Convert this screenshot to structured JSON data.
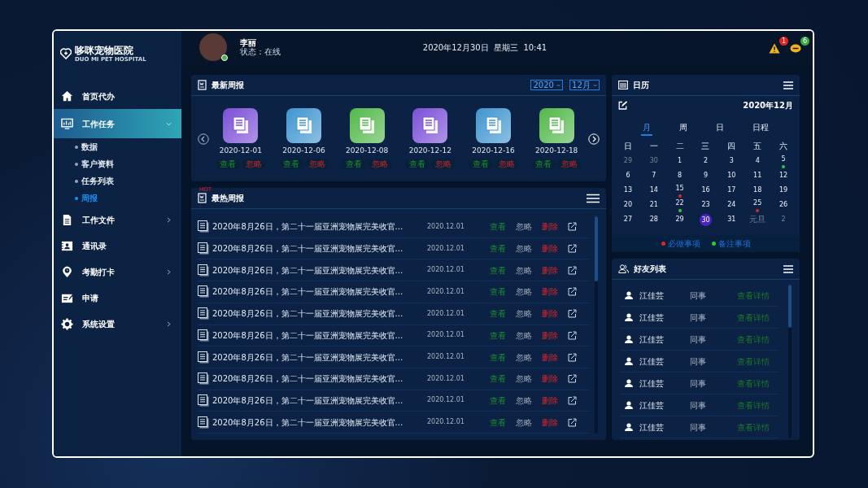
{
  "brand": {
    "name": "哆咪宠物医院",
    "tagline": "DUO MI PET HOSPITAL"
  },
  "sidebar": {
    "items": [
      {
        "kind": "link",
        "label": "首页代办",
        "selected": false
      },
      {
        "kind": "menu",
        "label": "工作任务",
        "selected": true,
        "expanded": true,
        "children": [
          {
            "label": "数据",
            "selected": false
          },
          {
            "label": "客户资料",
            "selected": false
          },
          {
            "label": "任务列表",
            "selected": false
          },
          {
            "label": "周报",
            "selected": true
          }
        ]
      },
      {
        "kind": "menu",
        "label": "工作文件",
        "selected": false,
        "expanded": false
      },
      {
        "kind": "link",
        "label": "通讯录",
        "selected": false
      },
      {
        "kind": "menu",
        "label": "考勤打卡",
        "selected": false,
        "expanded": false
      },
      {
        "kind": "link",
        "label": "申请",
        "selected": false
      },
      {
        "kind": "menu",
        "label": "系统设置",
        "selected": false,
        "expanded": false
      }
    ]
  },
  "header": {
    "user": {
      "name": "李丽",
      "status": "状态：在线",
      "online": true
    },
    "datetime": "2020年12月30日  星期三  10:41",
    "alerts": [
      {
        "count": "1",
        "color": "#e02424"
      },
      {
        "count": "6",
        "color": "#3aa845"
      }
    ]
  },
  "latest_reports": {
    "title": "最新周报",
    "year": "2020",
    "month": "12月",
    "cards": [
      {
        "date": "2020-12-01",
        "color": "#7b4fd6",
        "actions": [
          {
            "kind": "view",
            "label": "查看"
          },
          {
            "kind": "ignore",
            "label": "忽略"
          }
        ]
      },
      {
        "date": "2020-12-06",
        "color": "#3f95d0",
        "actions": [
          {
            "kind": "view",
            "label": "查看"
          },
          {
            "kind": "ignore",
            "label": "忽略"
          }
        ]
      },
      {
        "date": "2020-12-08",
        "color": "#52b84a",
        "actions": [
          {
            "kind": "view",
            "label": "查看"
          },
          {
            "kind": "ignore",
            "label": "忽略"
          }
        ]
      },
      {
        "date": "2020-12-12",
        "color": "#7b4fd6",
        "actions": [
          {
            "kind": "view",
            "label": "查看"
          },
          {
            "kind": "ignore",
            "label": "忽略"
          }
        ]
      },
      {
        "date": "2020-12-16",
        "color": "#3f95d0",
        "actions": [
          {
            "kind": "view",
            "label": "查看"
          },
          {
            "kind": "ignore",
            "label": "忽略"
          }
        ]
      },
      {
        "date": "2020-12-18",
        "color": "#52b84a",
        "actions": [
          {
            "kind": "view",
            "label": "查看"
          },
          {
            "kind": "ignore",
            "label": "忽略"
          }
        ]
      }
    ]
  },
  "hot_reports": {
    "title": "最热周报",
    "badge": "HOT",
    "rows": [
      {
        "title": "2020年8月26日，第二十一届亚洲宠物展完美收官...",
        "date": "2020.12.01",
        "actions": [
          {
            "kind": "view",
            "label": "查看"
          },
          {
            "kind": "ignore",
            "label": "忽略"
          },
          {
            "kind": "delete",
            "label": "删除"
          }
        ]
      },
      {
        "title": "2020年8月26日，第二十一届亚洲宠物展完美收官...",
        "date": "2020.12.01",
        "actions": [
          {
            "kind": "view",
            "label": "查看"
          },
          {
            "kind": "ignore",
            "label": "忽略"
          },
          {
            "kind": "delete",
            "label": "删除"
          }
        ]
      },
      {
        "title": "2020年8月26日，第二十一届亚洲宠物展完美收官...",
        "date": "2020.12.01",
        "actions": [
          {
            "kind": "view",
            "label": "查看"
          },
          {
            "kind": "ignore",
            "label": "忽略"
          },
          {
            "kind": "delete",
            "label": "删除"
          }
        ]
      },
      {
        "title": "2020年8月26日，第二十一届亚洲宠物展完美收官...",
        "date": "2020.12.01",
        "actions": [
          {
            "kind": "view",
            "label": "查看"
          },
          {
            "kind": "ignore",
            "label": "忽略"
          },
          {
            "kind": "delete",
            "label": "删除"
          }
        ]
      },
      {
        "title": "2020年8月26日，第二十一届亚洲宠物展完美收官...",
        "date": "2020.12.01",
        "actions": [
          {
            "kind": "view",
            "label": "查看"
          },
          {
            "kind": "ignore",
            "label": "忽略"
          },
          {
            "kind": "delete",
            "label": "删除"
          }
        ]
      },
      {
        "title": "2020年8月26日，第二十一届亚洲宠物展完美收官...",
        "date": "2020.12.01",
        "actions": [
          {
            "kind": "view",
            "label": "查看"
          },
          {
            "kind": "ignore",
            "label": "忽略"
          },
          {
            "kind": "delete",
            "label": "删除"
          }
        ]
      },
      {
        "title": "2020年8月26日，第二十一届亚洲宠物展完美收官...",
        "date": "2020.12.01",
        "actions": [
          {
            "kind": "view",
            "label": "查看"
          },
          {
            "kind": "ignore",
            "label": "忽略"
          },
          {
            "kind": "delete",
            "label": "删除"
          }
        ]
      },
      {
        "title": "2020年8月26日，第二十一届亚洲宠物展完美收官...",
        "date": "2020.12.01",
        "actions": [
          {
            "kind": "view",
            "label": "查看"
          },
          {
            "kind": "ignore",
            "label": "忽略"
          },
          {
            "kind": "delete",
            "label": "删除"
          }
        ]
      },
      {
        "title": "2020年8月26日，第二十一届亚洲宠物展完美收官...",
        "date": "2020.12.01",
        "actions": [
          {
            "kind": "view",
            "label": "查看"
          },
          {
            "kind": "ignore",
            "label": "忽略"
          },
          {
            "kind": "delete",
            "label": "删除"
          }
        ]
      },
      {
        "title": "2020年8月26日，第二十一届亚洲宠物展完美收官...",
        "date": "2020.12.01",
        "actions": [
          {
            "kind": "view",
            "label": "查看"
          },
          {
            "kind": "ignore",
            "label": "忽略"
          },
          {
            "kind": "delete",
            "label": "删除"
          }
        ]
      }
    ]
  },
  "calendar": {
    "title": "日历",
    "month": "2020年12月",
    "views": [
      {
        "label": "月",
        "selected": true
      },
      {
        "label": "周",
        "selected": false
      },
      {
        "label": "日",
        "selected": false
      },
      {
        "label": "日程",
        "selected": false
      }
    ],
    "weekdays": [
      "日",
      "一",
      "二",
      "三",
      "四",
      "五",
      "六"
    ],
    "weeks": [
      [
        {
          "day": "29",
          "muted": true,
          "selected": false
        },
        {
          "day": "30",
          "muted": true,
          "selected": false
        },
        {
          "day": "1",
          "muted": false,
          "selected": false
        },
        {
          "day": "2",
          "muted": false,
          "selected": false
        },
        {
          "day": "3",
          "muted": false,
          "selected": false
        },
        {
          "day": "4",
          "muted": false,
          "selected": false
        },
        {
          "day": "5",
          "muted": false,
          "selected": false,
          "color": "#2ecc2e"
        }
      ],
      [
        {
          "day": "6",
          "muted": false,
          "selected": false
        },
        {
          "day": "7",
          "muted": false,
          "selected": false
        },
        {
          "day": "8",
          "muted": false,
          "selected": false
        },
        {
          "day": "9",
          "muted": false,
          "selected": false
        },
        {
          "day": "10",
          "muted": false,
          "selected": false
        },
        {
          "day": "11",
          "muted": false,
          "selected": false
        },
        {
          "day": "12",
          "muted": false,
          "selected": false
        }
      ],
      [
        {
          "day": "13",
          "muted": false,
          "selected": false
        },
        {
          "day": "14",
          "muted": false,
          "selected": false
        },
        {
          "day": "15",
          "muted": false,
          "selected": false,
          "color": "#e02424"
        },
        {
          "day": "16",
          "muted": false,
          "selected": false
        },
        {
          "day": "17",
          "muted": false,
          "selected": false
        },
        {
          "day": "18",
          "muted": false,
          "selected": false
        },
        {
          "day": "19",
          "muted": false,
          "selected": false
        }
      ],
      [
        {
          "day": "20",
          "muted": false,
          "selected": false
        },
        {
          "day": "21",
          "muted": false,
          "selected": false
        },
        {
          "day": "22",
          "muted": false,
          "selected": false,
          "color": "#2ecc2e"
        },
        {
          "day": "23",
          "muted": false,
          "selected": false
        },
        {
          "day": "24",
          "muted": false,
          "selected": false
        },
        {
          "day": "25",
          "muted": false,
          "selected": false,
          "color": "#e02424"
        },
        {
          "day": "26",
          "muted": false,
          "selected": false
        }
      ],
      [
        {
          "day": "27",
          "muted": false,
          "selected": false
        },
        {
          "day": "28",
          "muted": false,
          "selected": false
        },
        {
          "day": "29",
          "muted": false,
          "selected": false
        },
        {
          "day": "30",
          "muted": false,
          "selected": true
        },
        {
          "day": "31",
          "muted": false,
          "selected": false
        },
        {
          "day": "元旦",
          "muted": true,
          "selected": false
        },
        {
          "day": "2",
          "muted": true,
          "selected": false
        }
      ]
    ],
    "legend": [
      {
        "label": "必做事项",
        "color": "#e02424"
      },
      {
        "label": "备注事项",
        "color": "#2ecc2e"
      }
    ]
  },
  "friends": {
    "title": "好友列表",
    "rows": [
      {
        "name": "江佳芸",
        "relation": "同事",
        "action": "查看详情"
      },
      {
        "name": "江佳芸",
        "relation": "同事",
        "action": "查看详情"
      },
      {
        "name": "江佳芸",
        "relation": "同事",
        "action": "查看详情"
      },
      {
        "name": "江佳芸",
        "relation": "同事",
        "action": "查看详情"
      },
      {
        "name": "江佳芸",
        "relation": "同事",
        "action": "查看详情"
      },
      {
        "name": "江佳芸",
        "relation": "同事",
        "action": "查看详情"
      },
      {
        "name": "江佳芸",
        "relation": "同事",
        "action": "查看详情"
      }
    ]
  }
}
